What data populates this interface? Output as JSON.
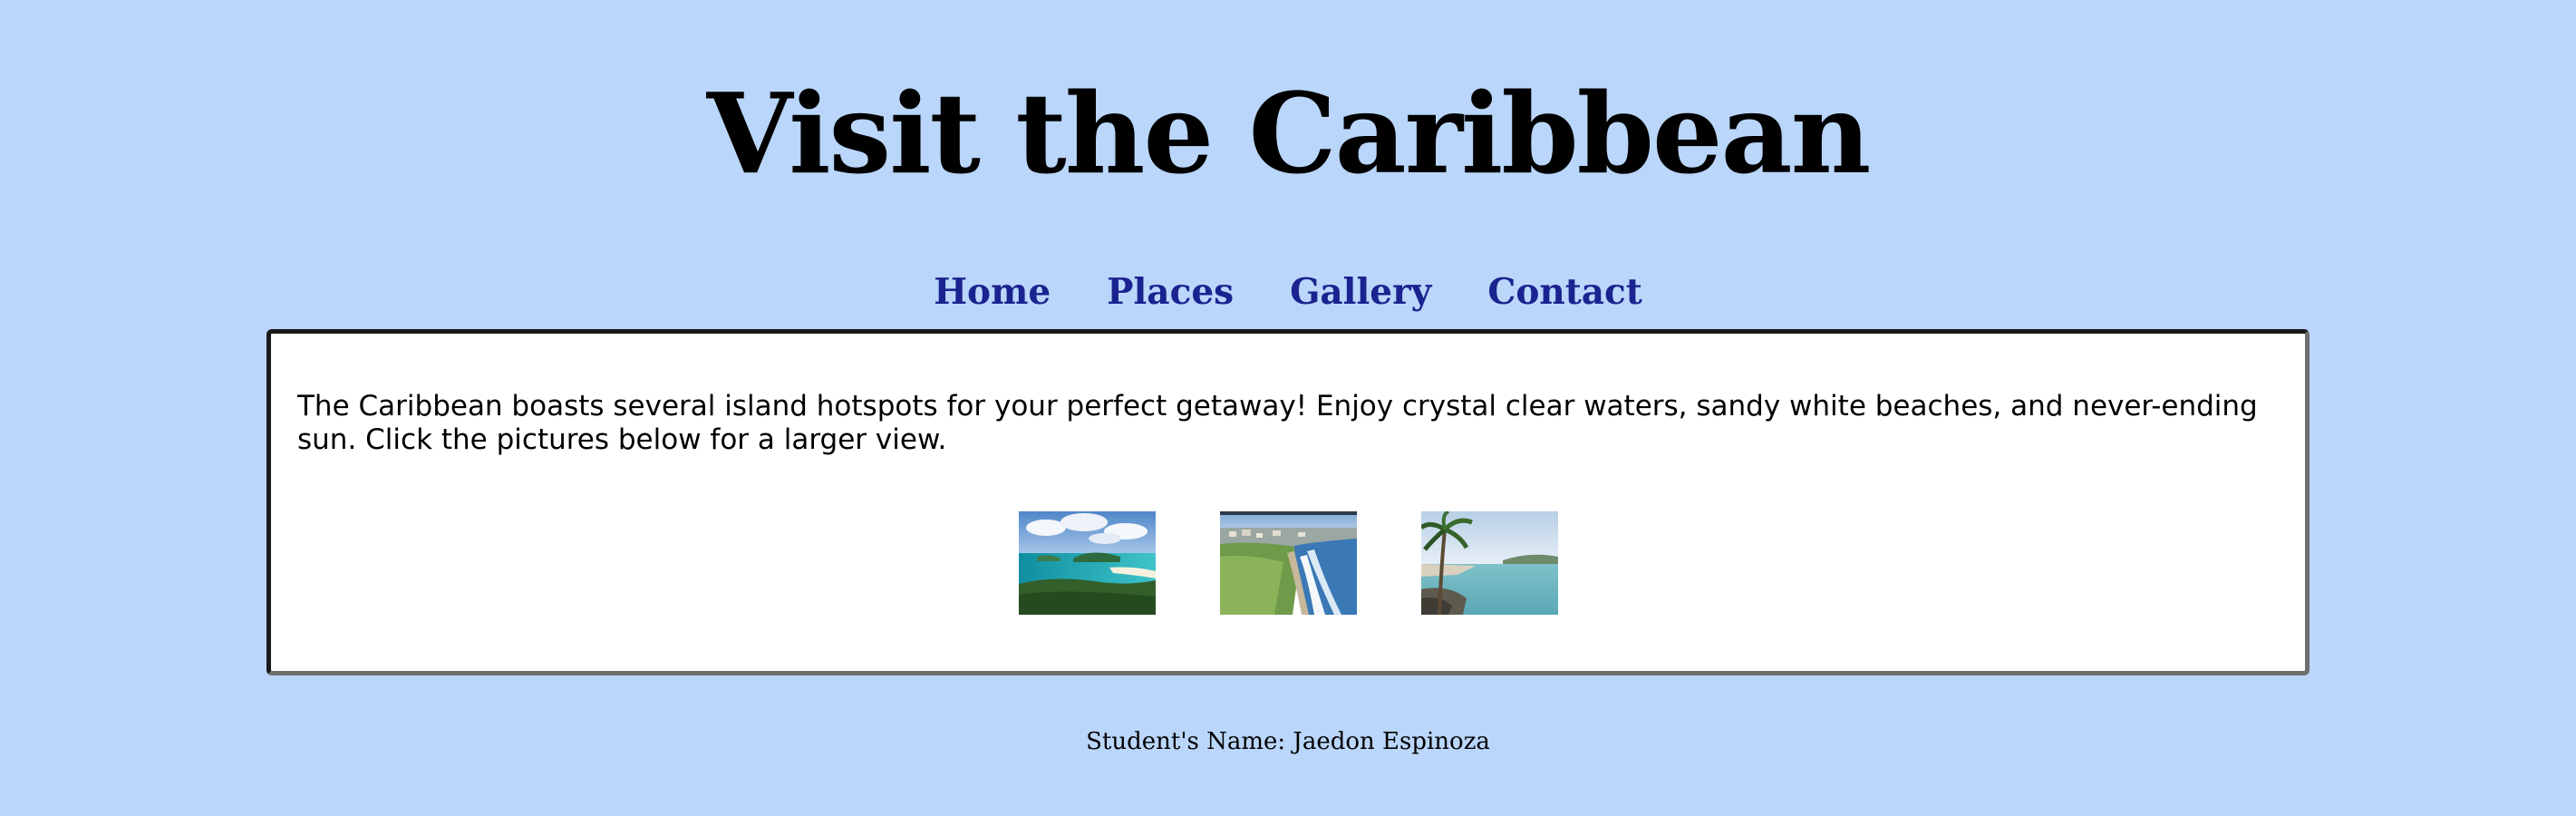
{
  "header": {
    "title": "Visit the Caribbean"
  },
  "nav": {
    "items": [
      {
        "label": "Home"
      },
      {
        "label": "Places"
      },
      {
        "label": "Gallery"
      },
      {
        "label": "Contact"
      }
    ]
  },
  "main": {
    "intro": "The Caribbean boasts several island hotspots for your perfect getaway! Enjoy crystal clear waters, sandy white beaches, and never-ending sun. Click the pictures below for a larger view.",
    "thumbnails": [
      {
        "subject": "turquoise-bay-beach-photo"
      },
      {
        "subject": "coastal-cliff-town-photo"
      },
      {
        "subject": "palm-tree-lagoon-photo"
      }
    ]
  },
  "footer": {
    "student_name": "Student's Name: Jaedon Espinoza"
  },
  "colors": {
    "background": "#bad6fa",
    "nav_link": "#1a238f",
    "content_bg": "#ffffff"
  }
}
